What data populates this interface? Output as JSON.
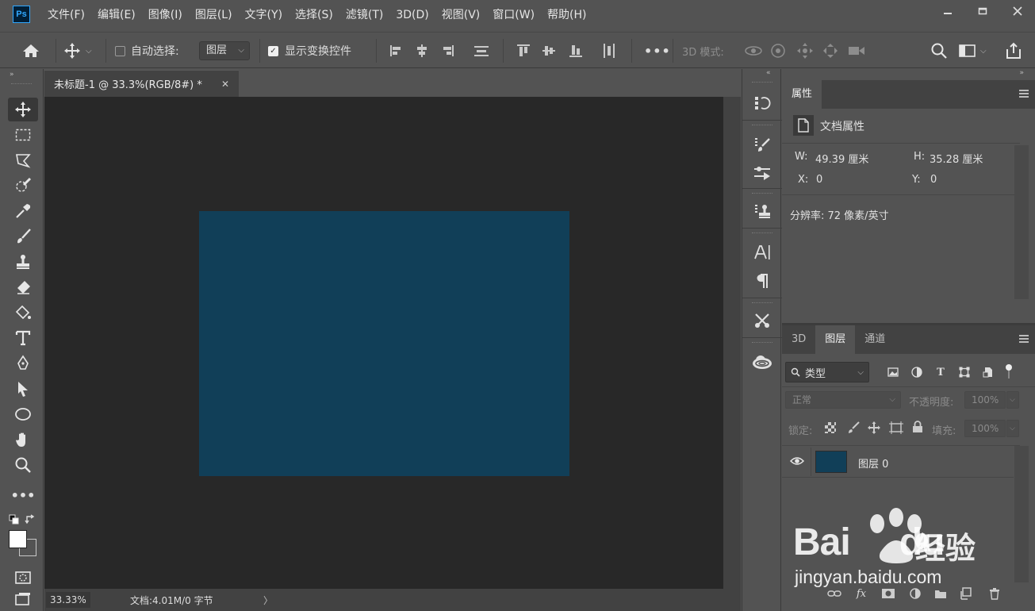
{
  "app": {
    "logo_text": "Ps"
  },
  "menu": [
    "文件(F)",
    "编辑(E)",
    "图像(I)",
    "图层(L)",
    "文字(Y)",
    "选择(S)",
    "滤镜(T)",
    "3D(D)",
    "视图(V)",
    "窗口(W)",
    "帮助(H)"
  ],
  "options_bar": {
    "auto_select_label": "自动选择:",
    "auto_select_checked": false,
    "auto_select_target": "图层",
    "show_transform_label": "显示变换控件",
    "show_transform_checked": true,
    "more_label": "•••",
    "mode_3d_label": "3D 模式:"
  },
  "document": {
    "tab_title": "未标题-1 @ 33.3%(RGB/8#) *",
    "canvas_color": "#113f58",
    "zoom": "33.33%",
    "doc_info": "文档:4.01M/0 字节"
  },
  "properties_panel": {
    "tab": "属性",
    "section_title": "文档属性",
    "w_label": "W:",
    "w_value": "49.39 厘米",
    "h_label": "H:",
    "h_value": "35.28 厘米",
    "x_label": "X:",
    "x_value": "0",
    "y_label": "Y:",
    "y_value": "0",
    "resolution": "分辨率: 72 像素/英寸"
  },
  "layers_panel": {
    "tabs": [
      "3D",
      "图层",
      "通道"
    ],
    "active_tab": "图层",
    "filter_label": "类型",
    "blend_mode": "正常",
    "opacity_label": "不透明度:",
    "opacity_value": "100%",
    "lock_label": "锁定:",
    "fill_label": "填充:",
    "fill_value": "100%",
    "layers": [
      {
        "name": "图层 0",
        "visible": true,
        "thumb_color": "#113f58"
      }
    ]
  },
  "watermark": {
    "brand": "Bai",
    "brand2": "du",
    "cn": "经验",
    "url": "jingyan.baidu.com"
  }
}
